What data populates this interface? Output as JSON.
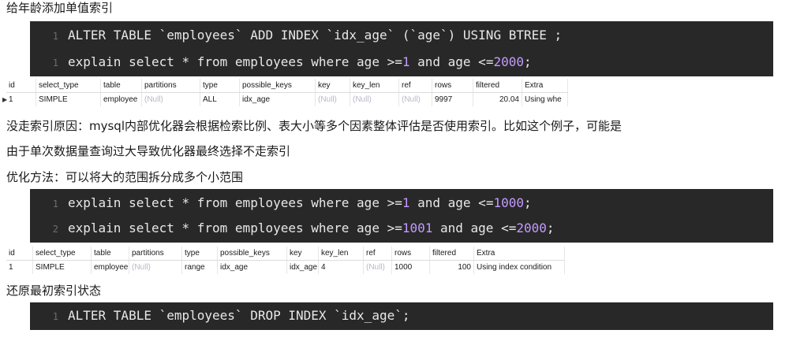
{
  "heading_add_index": "给年龄添加单值索引",
  "code_block_1": {
    "lines": [
      {
        "num": "1",
        "text": "ALTER TABLE `employees` ADD INDEX `idx_age` (`age`) USING BTREE ;"
      },
      {
        "num": "1",
        "pre": "explain select * from employees where age >=",
        "n1": "1",
        "mid": " and age <=",
        "n2": "2000",
        "post": ";"
      }
    ]
  },
  "result_table_1": {
    "headers": [
      "id",
      "select_type",
      "table",
      "partitions",
      "type",
      "possible_keys",
      "key",
      "key_len",
      "ref",
      "rows",
      "filtered",
      "Extra"
    ],
    "row": [
      "1",
      "SIMPLE",
      "employee",
      "(Null)",
      "ALL",
      "idx_age",
      "(Null)",
      "(Null)",
      "(Null)",
      "9997",
      "20.04",
      "Using whe"
    ]
  },
  "explanation_line_1": "没走索引原因：mysql内部优化器会根据检索比例、表大小等多个因素整体评估是否使用索引。比如这个例子，可能是",
  "explanation_line_2": "由于单次数据量查询过大导致优化器最终选择不走索引",
  "optimization_heading": "优化方法：可以将大的范围拆分成多个小范围",
  "code_block_2": {
    "lines": [
      {
        "num": "1",
        "pre": "explain select * from employees where age >=",
        "n1": "1",
        "mid": " and age <=",
        "n2": "1000",
        "post": ";"
      },
      {
        "num": "2",
        "pre": "explain select * from employees where age >=",
        "n1": "1001",
        "mid": " and age <=",
        "n2": "2000",
        "post": ";"
      }
    ]
  },
  "result_table_2": {
    "headers": [
      "id",
      "select_type",
      "table",
      "partitions",
      "type",
      "possible_keys",
      "key",
      "key_len",
      "ref",
      "rows",
      "filtered",
      "Extra"
    ],
    "row": [
      "1",
      "SIMPLE",
      "employee",
      "(Null)",
      "range",
      "idx_age",
      "idx_age",
      "4",
      "(Null)",
      "1000",
      "100",
      "Using index condition"
    ]
  },
  "restore_heading": "还原最初索引状态",
  "code_block_3": {
    "lines": [
      {
        "num": "1",
        "text": "ALTER TABLE `employees` DROP INDEX `idx_age`;"
      }
    ]
  }
}
